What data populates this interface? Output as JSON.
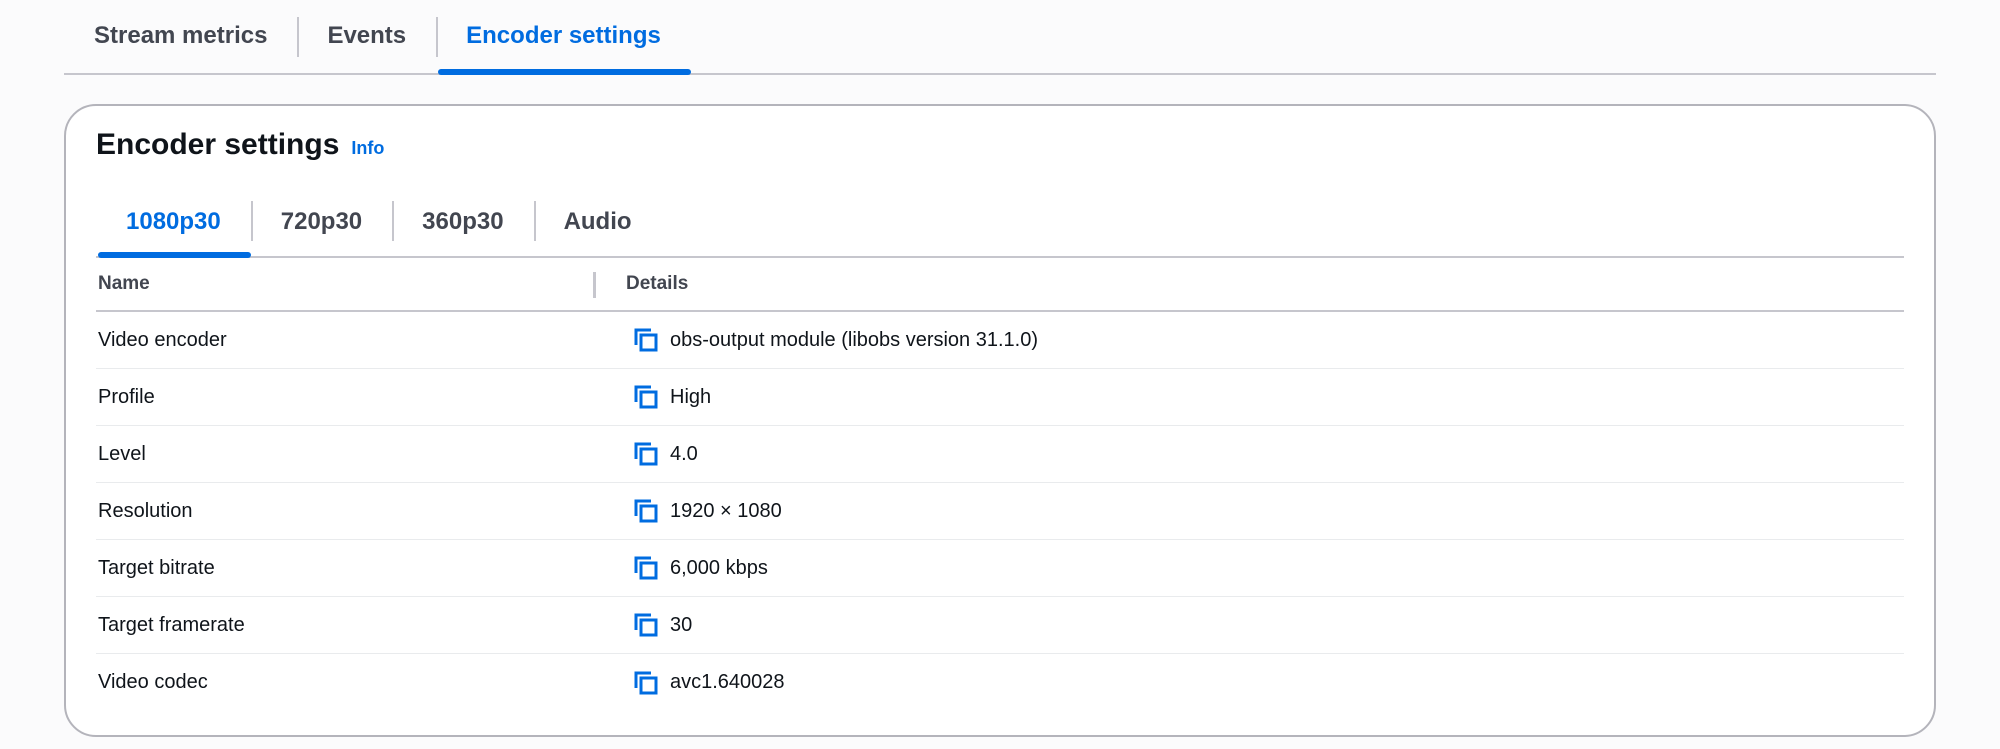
{
  "top_tabs": [
    {
      "label": "Stream metrics"
    },
    {
      "label": "Events"
    },
    {
      "label": "Encoder settings"
    }
  ],
  "top_tabs_active": 2,
  "container": {
    "title": "Encoder settings",
    "info_label": "Info"
  },
  "inner_tabs": [
    {
      "label": "1080p30"
    },
    {
      "label": "720p30"
    },
    {
      "label": "360p30"
    },
    {
      "label": "Audio"
    }
  ],
  "inner_tabs_active": 0,
  "table": {
    "headers": {
      "name": "Name",
      "details": "Details"
    },
    "rows": [
      {
        "name": "Video encoder",
        "details": "obs-output module (libobs version 31.1.0)"
      },
      {
        "name": "Profile",
        "details": "High"
      },
      {
        "name": "Level",
        "details": "4.0"
      },
      {
        "name": "Resolution",
        "details": "1920 × 1080"
      },
      {
        "name": "Target bitrate",
        "details": "6,000 kbps"
      },
      {
        "name": "Target framerate",
        "details": "30"
      },
      {
        "name": "Video codec",
        "details": "avc1.640028"
      }
    ]
  },
  "icons": {
    "copy": "copy-icon"
  },
  "colors": {
    "accent": "#006ce0",
    "text": "#0f141a",
    "muted": "#424650",
    "border": "#c6c6cd"
  }
}
